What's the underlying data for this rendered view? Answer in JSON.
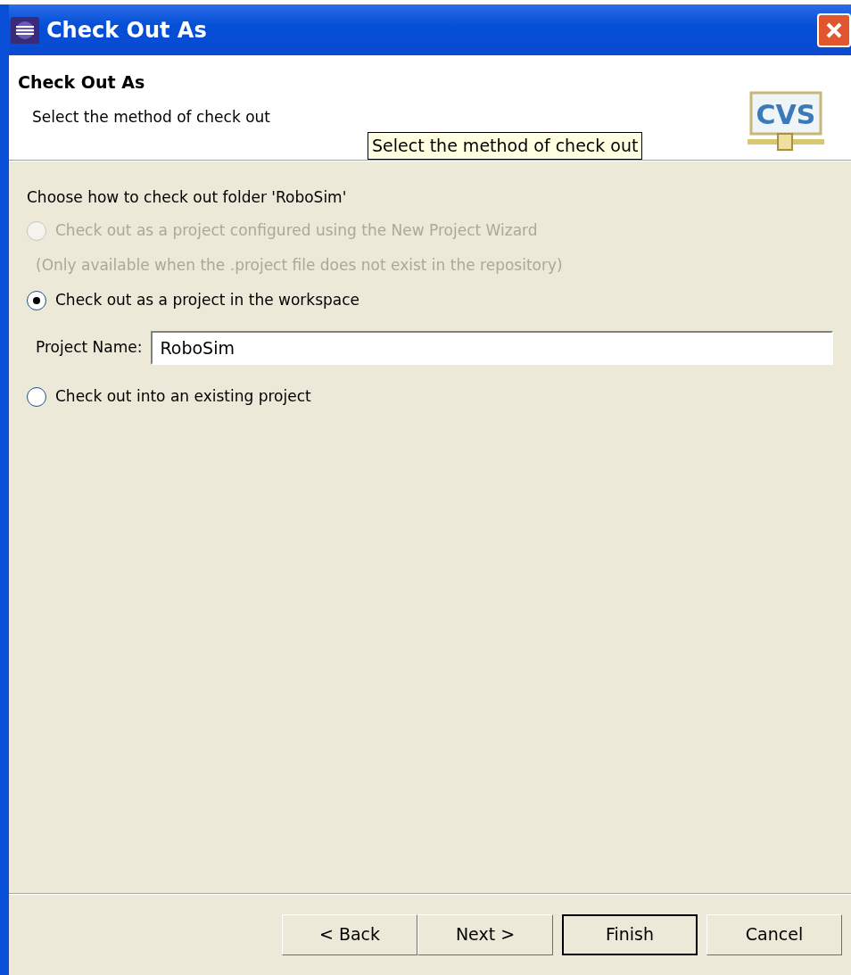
{
  "window": {
    "title": "Check Out As"
  },
  "header": {
    "title": "Check Out As",
    "description": "Select the method of check out",
    "tooltip": "Select the method of check out",
    "logo_text": "CVS"
  },
  "body": {
    "prompt": "Choose how to check out folder 'RoboSim'",
    "items": [
      {
        "kind": "radio",
        "label": "Check out as a project configured using the New Project Wizard",
        "selected": false,
        "disabled": true
      },
      {
        "kind": "hint",
        "text": "(Only available when the .project file does not exist in the repository)",
        "disabled": true
      },
      {
        "kind": "radio",
        "label": "Check out as a project in the workspace",
        "selected": true,
        "disabled": false
      },
      {
        "kind": "field",
        "label": "Project Name:",
        "value": "RoboSim"
      },
      {
        "kind": "radio",
        "label": "Check out into an existing project",
        "selected": false,
        "disabled": false
      }
    ]
  },
  "buttons": [
    {
      "label": "< Back",
      "default": false
    },
    {
      "label": "Next >",
      "default": false
    },
    {
      "label": "Finish",
      "default": true
    },
    {
      "label": "Cancel",
      "default": false
    }
  ]
}
